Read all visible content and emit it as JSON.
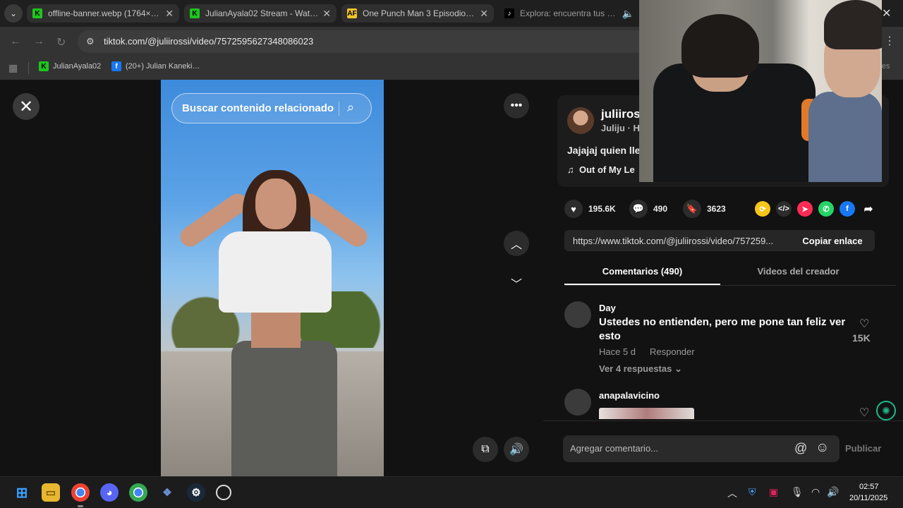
{
  "browser": {
    "tabs": [
      {
        "title": "offline-banner.webp (1764×99…",
        "favicon": "kick-icon"
      },
      {
        "title": "JulianAyala02 Stream - Watch L…",
        "favicon": "kick-icon"
      },
      {
        "title": "One Punch Man 3 Episodio 6 S…",
        "favicon": "animeflv-icon"
      },
      {
        "title": "Explora: encuentra tus vide…",
        "favicon": "tiktok-icon",
        "active": true
      }
    ],
    "url": "tiktok.com/@juliirossi/video/7572595627348086023",
    "bookmarks": [
      {
        "label": "JulianAyala02",
        "favicon": "kick-icon"
      },
      {
        "label": "(20+) Julian Kaneki…",
        "favicon": "facebook-icon"
      }
    ],
    "bookmarks_overflow": "pres"
  },
  "video": {
    "search_related_placeholder": "Buscar contenido relacionado"
  },
  "post": {
    "username": "juliiros",
    "nickname": "Juliju · H",
    "description": "Jajajaj quien lle",
    "music": "Out of My Le",
    "likes": "195.6K",
    "comments": "490",
    "saves": "3623",
    "link": "https://www.tiktok.com/@juliirossi/video/757259...",
    "copy_link_label": "Copiar enlace"
  },
  "panel_tabs": [
    {
      "label": "Comentarios (490)",
      "active": true
    },
    {
      "label": "Videos del creador",
      "active": false
    }
  ],
  "comments": [
    {
      "user": "Day",
      "text": "Ustedes no entienden, pero me pone tan feliz ver esto",
      "time": "Hace 5 d",
      "reply_label": "Responder",
      "more_replies": "Ver 4 respuestas",
      "likes": "15K"
    },
    {
      "user": "anapalavicino"
    }
  ],
  "comment_bar": {
    "placeholder": "Agregar comentario...",
    "publish_label": "Publicar"
  },
  "taskbar": {
    "time": "02:57",
    "date": "20/11/2025"
  },
  "colors": {
    "tiktok_red": "#fe2c55",
    "share_facebook": "#1877f2",
    "share_whatsapp": "#25d366",
    "share_repost": "#f5c518"
  }
}
